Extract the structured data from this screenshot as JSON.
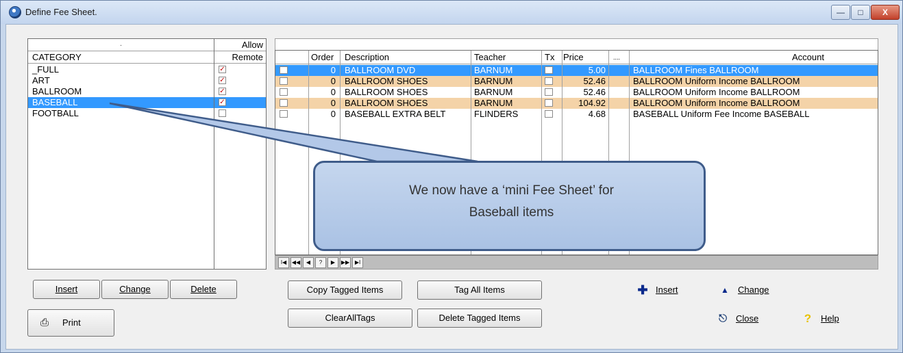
{
  "window": {
    "title": "Define Fee Sheet.",
    "min": "—",
    "max": "□",
    "close": "X"
  },
  "categories": {
    "header_top": ".",
    "header_allow": "Allow",
    "header_category": "CATEGORY",
    "header_remote": "Remote",
    "selected_index": 3,
    "items": [
      {
        "label": "_FULL",
        "allow_remote": true
      },
      {
        "label": "ART",
        "allow_remote": true
      },
      {
        "label": "BALLROOM",
        "allow_remote": true
      },
      {
        "label": "BASEBALL",
        "allow_remote": true
      },
      {
        "label": "FOOTBALL",
        "allow_remote": false
      }
    ]
  },
  "fees": {
    "columns": {
      "order": "Order",
      "description": "Description",
      "teacher": "Teacher",
      "tx": "Tx",
      "price": "Price",
      "more": "....",
      "account": "Account"
    },
    "rows": [
      {
        "order": "0",
        "description": "BALLROOM DVD",
        "teacher": "BARNUM",
        "price": "5.00",
        "account": "BALLROOM Fines BALLROOM",
        "style": "sel"
      },
      {
        "order": "0",
        "description": "BALLROOM SHOES",
        "teacher": "BARNUM",
        "price": "52.46",
        "account": "BALLROOM Uniform Income BALLROOM",
        "style": "alt"
      },
      {
        "order": "0",
        "description": "BALLROOM SHOES",
        "teacher": "BARNUM",
        "price": "52.46",
        "account": "BALLROOM Uniform Income BALLROOM",
        "style": ""
      },
      {
        "order": "0",
        "description": "BALLROOM SHOES",
        "teacher": "BARNUM",
        "price": "104.92",
        "account": "BALLROOM Uniform Income BALLROOM",
        "style": "alt"
      },
      {
        "order": "0",
        "description": "BASEBALL EXTRA BELT",
        "teacher": "FLINDERS",
        "price": "4.68",
        "account": "BASEBALL Uniform Fee Income BASEBALL",
        "style": ""
      }
    ],
    "nav": [
      "I◀",
      "◀◀",
      "◀",
      "?",
      "▶",
      "▶▶",
      "▶I"
    ]
  },
  "left_buttons": {
    "insert": "Insert",
    "change": "Change",
    "delete": "Delete",
    "print": "Print"
  },
  "mid_buttons": {
    "copy_tagged": "Copy Tagged Items",
    "tag_all": "Tag All Items",
    "clear_all_tags": "ClearAllTags",
    "delete_tagged": "Delete Tagged Items"
  },
  "tools": {
    "insert": "Insert",
    "change": "Change",
    "close": "Close",
    "help": "Help"
  },
  "callout": {
    "line1": "We now have a ‘mini Fee Sheet’ for",
    "line2": "Baseball items"
  },
  "colors": {
    "selection": "#3399ff",
    "alt_row": "#f4d3a8",
    "callout_border": "#3f5c8a",
    "insert_icon": "#0b2a8c"
  }
}
